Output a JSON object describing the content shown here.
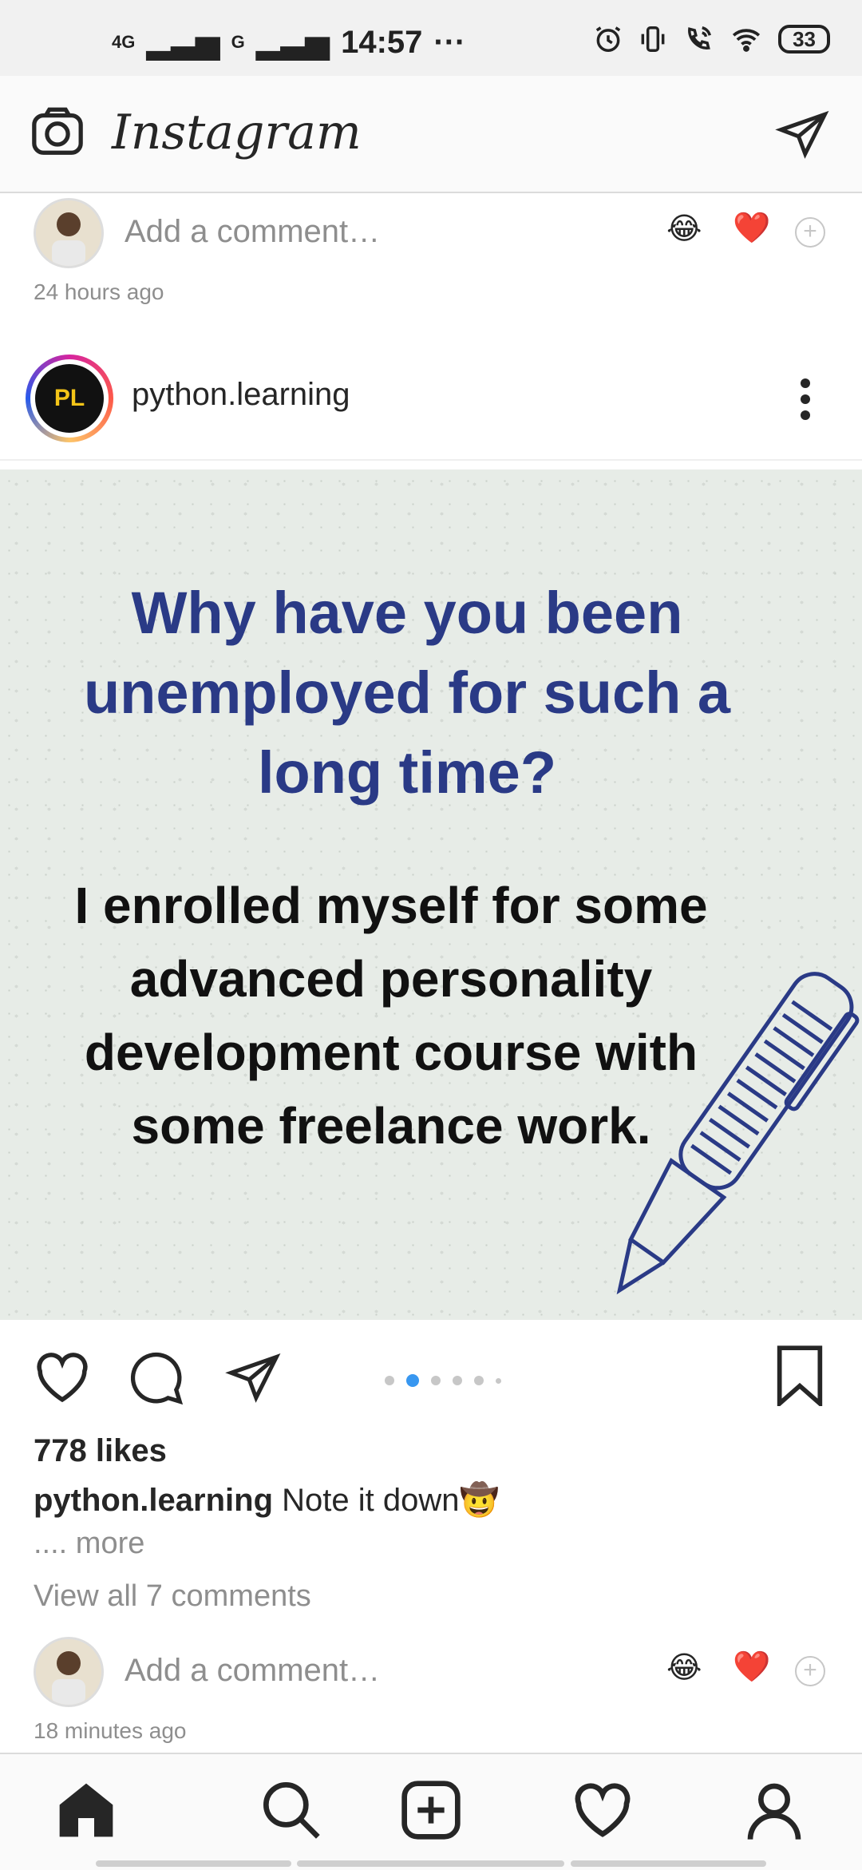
{
  "status_bar": {
    "network1": "4G",
    "network2": "G",
    "time": "14:57",
    "more": "···",
    "battery": "33"
  },
  "header": {
    "app_title": "Instagram"
  },
  "prev_post": {
    "comment_placeholder": "Add a comment…",
    "time_ago": "24 hours ago",
    "reactions": [
      "😂",
      "❤️"
    ]
  },
  "post": {
    "username": "python.learning",
    "profile_initials": "PL",
    "image_question": "Why have you been unemployed for such a long time?",
    "image_answer": "I enrolled myself for some advanced personality development course with some freelance work.",
    "likes": "778 likes",
    "caption_user": "python.learning",
    "caption_text": "Note it down🤠",
    "more": ".... more",
    "view_comments": "View all 7 comments",
    "comment_placeholder": "Add a comment…",
    "time_ago": "18 minutes ago",
    "carousel": {
      "count": 6,
      "active": 1
    }
  },
  "colors": {
    "accent_blue": "#3897f0",
    "like_red": "#ed4956",
    "question_blue": "#2a3a86"
  },
  "nav": {
    "items": [
      "home-icon",
      "search-icon",
      "new-post-icon",
      "activity-icon",
      "profile-icon"
    ]
  }
}
